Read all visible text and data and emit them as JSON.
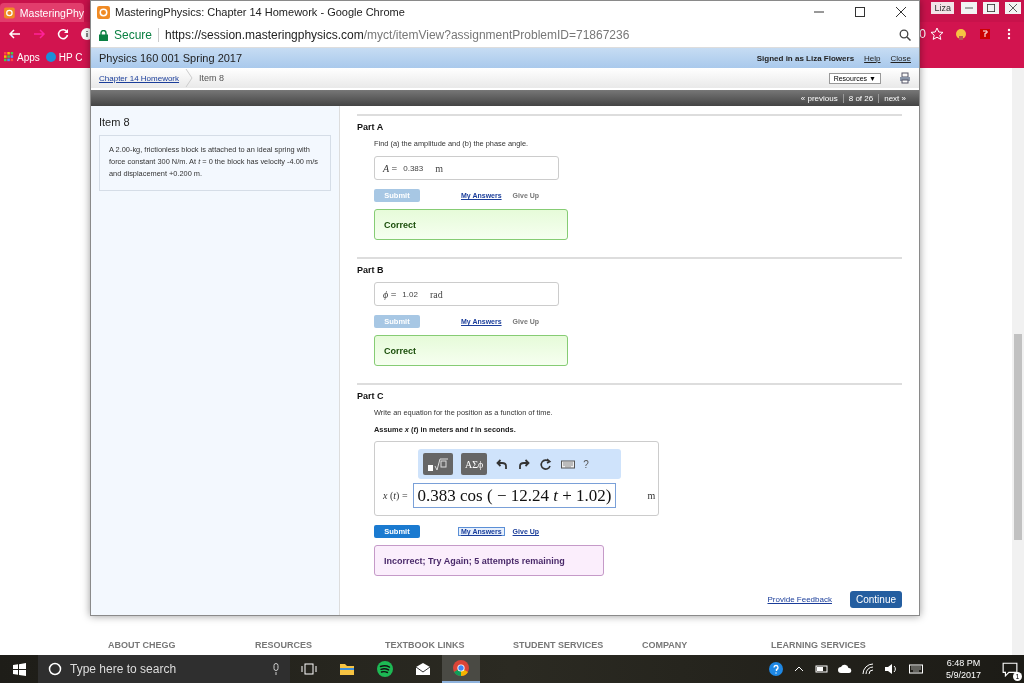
{
  "back_window": {
    "tab_title": "MasteringPhy",
    "profile": "Liza",
    "address_tail": "0",
    "bookmarks": [
      {
        "kind": "apps",
        "label": "Apps"
      },
      {
        "kind": "hp",
        "label": "HP C"
      }
    ],
    "footer_links": [
      "ABOUT CHEGG",
      "RESOURCES",
      "TEXTBOOK LINKS",
      "STUDENT SERVICES",
      "COMPANY",
      "LEARNING SERVICES"
    ]
  },
  "taskbar": {
    "search_placeholder": "Type here to search",
    "apps": [
      {
        "kind": "task-view",
        "selected": false
      },
      {
        "kind": "files",
        "selected": false
      },
      {
        "kind": "music",
        "selected": false
      },
      {
        "kind": "mail",
        "selected": false
      },
      {
        "kind": "browser",
        "selected": true
      }
    ],
    "time": "6:48 PM",
    "date": "5/9/2017",
    "notifications": "1"
  },
  "window": {
    "title": "MasteringPhysics: Chapter 14 Homework - Google Chrome",
    "secure_label": "Secure",
    "url_host": "https://session.masteringphysics.com",
    "url_path": "/myct/itemView?assignmentProblemID=71867236"
  },
  "header": {
    "course": "Physics 160 001 Spring 2017",
    "signed_in": "Signed in as Liza Flowers",
    "links": [
      "Help",
      "Close"
    ]
  },
  "breadcrumb": {
    "parent": "Chapter 14 Homework",
    "current": "Item 8",
    "resources": "Resources ▼"
  },
  "pager": {
    "previous": "« previous",
    "position": "8 of 26",
    "next": "next »"
  },
  "item": {
    "title": "Item 8",
    "problem": "A 2.00-kg, frictionless block is attached to an ideal spring with force constant 300 N/m. At *t* = 0 the block has velocity -4.00 m/s and displacement +0.200 m."
  },
  "parts": [
    {
      "kind": "numeric",
      "title": "Part A",
      "prompt": "Find (a) the amplitude and (b) the phase angle.",
      "answer": {
        "label": "*A* =",
        "value": "0.383",
        "unit": "m"
      },
      "submit": {
        "label": "Submit",
        "disabled": true
      },
      "my_answers": {
        "label": "My Answers",
        "focused": false
      },
      "give_up": {
        "label": "Give Up",
        "disabled": true
      },
      "feedback": {
        "kind": "correct",
        "text": "Correct"
      }
    },
    {
      "kind": "numeric",
      "title": "Part B",
      "answer": {
        "label": "*ϕ* =",
        "value": "1.02",
        "unit": "rad"
      },
      "submit": {
        "label": "Submit",
        "disabled": true
      },
      "my_answers": {
        "label": "My Answers",
        "focused": false
      },
      "give_up": {
        "label": "Give Up",
        "disabled": true
      },
      "feedback": {
        "kind": "correct",
        "text": "Correct"
      }
    },
    {
      "kind": "expression",
      "title": "Part C",
      "prompt": "Write an equation for the position as a function of time.",
      "instruction": "Assume *x* (*t*) in meters and *t* in seconds.",
      "toolbar": [
        {
          "kind": "templates"
        },
        {
          "kind": "symbols",
          "label": "ΑΣϕ"
        },
        {
          "kind": "undo"
        },
        {
          "kind": "redo"
        },
        {
          "kind": "reset"
        },
        {
          "kind": "keyboard"
        },
        {
          "kind": "help",
          "label": "?"
        }
      ],
      "answer": {
        "label": "*x* (*t*) =",
        "value": "0.383 cos ( − 12.24 *t* + 1.02)",
        "unit": "m"
      },
      "submit": {
        "label": "Submit",
        "disabled": false
      },
      "my_answers": {
        "label": "My Answers",
        "focused": true
      },
      "give_up": {
        "label": "Give Up",
        "disabled": false
      },
      "feedback": {
        "kind": "incorrect",
        "text": "Incorrect; Try Again; 5 attempts remaining"
      }
    }
  ],
  "footer": {
    "feedback_link": "Provide Feedback",
    "continue": "Continue"
  }
}
